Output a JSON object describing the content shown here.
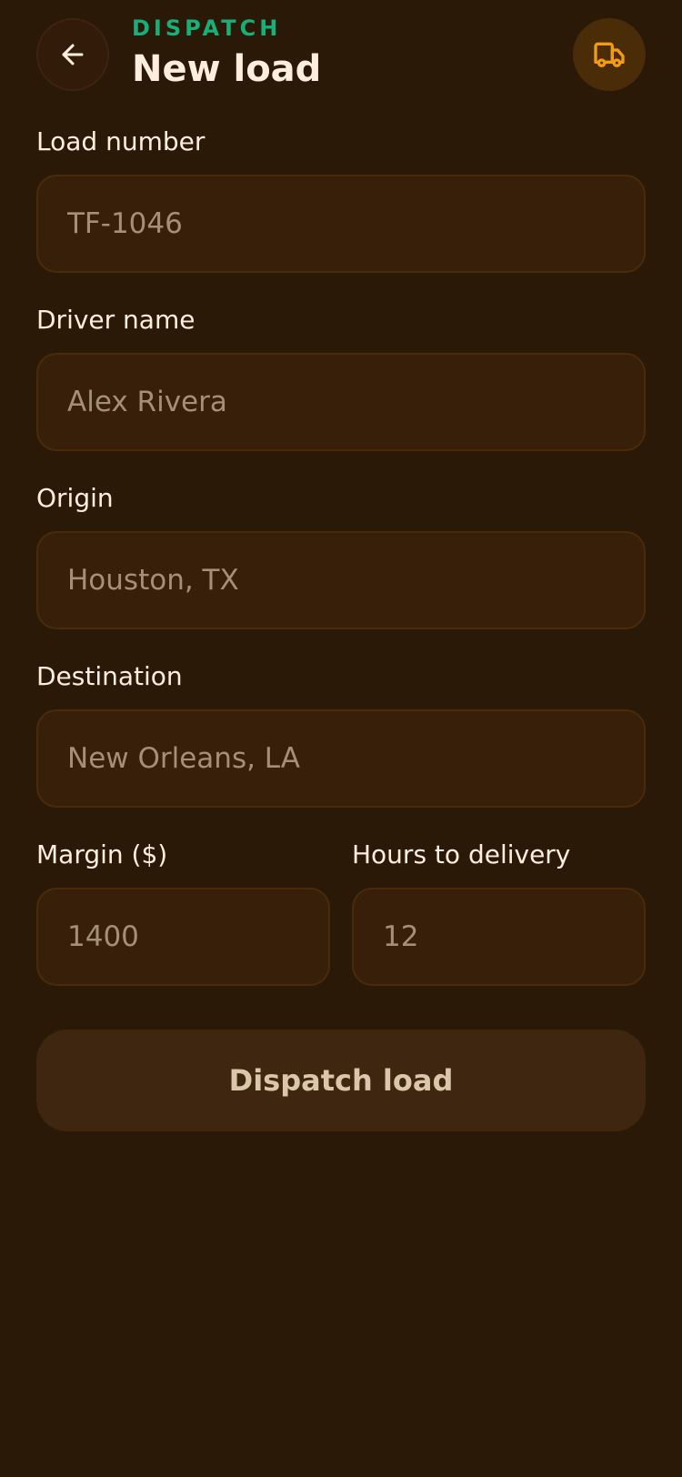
{
  "header": {
    "eyebrow": "DISPATCH",
    "title": "New load",
    "back_icon": "arrow-left-icon",
    "status_icon": "truck-icon"
  },
  "form": {
    "load_number": {
      "label": "Load number",
      "placeholder": "TF-1046",
      "value": ""
    },
    "driver_name": {
      "label": "Driver name",
      "placeholder": "Alex Rivera",
      "value": ""
    },
    "origin": {
      "label": "Origin",
      "placeholder": "Houston, TX",
      "value": ""
    },
    "destination": {
      "label": "Destination",
      "placeholder": "New Orleans, LA",
      "value": ""
    },
    "margin": {
      "label": "Margin ($)",
      "placeholder": "1400",
      "value": ""
    },
    "hours_to_delivery": {
      "label": "Hours to delivery",
      "placeholder": "12",
      "value": ""
    },
    "submit_label": "Dispatch load"
  },
  "colors": {
    "background": "#2a1906",
    "field_background": "#371f09",
    "field_border": "#4a2a0d",
    "accent_green": "#17b07a",
    "accent_orange": "#f39c12",
    "text_primary": "#fdeedd",
    "text_placeholder": "#a58f79",
    "button_background": "#3f2610",
    "button_text": "#dcc6a9"
  }
}
